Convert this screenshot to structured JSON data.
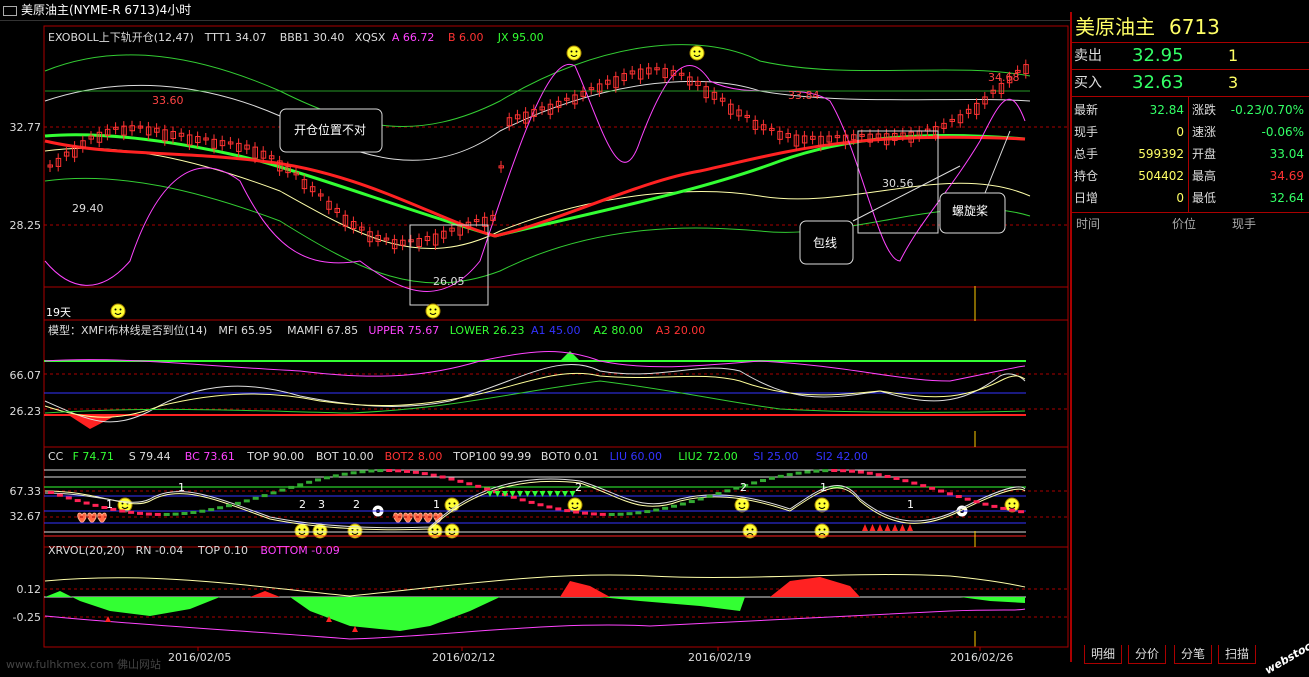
{
  "window": {
    "title": "美原油主(NYME-R 6713)4小时"
  },
  "main_panel": {
    "indicator_line": [
      {
        "text": "EXOBOLL上下轨开仓(12,47)",
        "color": "#dddddd"
      },
      {
        "text": "TTT1 34.07",
        "color": "#dddddd"
      },
      {
        "text": "BBB1 30.40",
        "color": "#dddddd"
      },
      {
        "text": "XQSX",
        "color": "#dddddd"
      },
      {
        "text": "A 66.72",
        "color": "#ff44ff"
      },
      {
        "text": "B 6.00",
        "color": "#ff3333"
      },
      {
        "text": "JX 95.00",
        "color": "#33ff33"
      }
    ],
    "y_ticks": [
      "32.77",
      "28.25"
    ],
    "price_labels": [
      "33.60",
      "29.40",
      "26.05",
      "33.84",
      "34.68",
      "30.56"
    ],
    "annotations": [
      "开仓位置不对",
      "包线",
      "螺旋桨"
    ],
    "days_label": "19天"
  },
  "mfi_panel": {
    "indicator_line": [
      {
        "text": "模型：XMFI布林线是否到位(14)",
        "color": "#dddddd"
      },
      {
        "text": "MFI 65.95",
        "color": "#dddddd"
      },
      {
        "text": "MAMFI 67.85",
        "color": "#dddddd"
      },
      {
        "text": "UPPER 75.67",
        "color": "#ff44ff"
      },
      {
        "text": "LOWER 26.23",
        "color": "#33ff33"
      },
      {
        "text": "A1 45.00",
        "color": "#3333ff"
      },
      {
        "text": "A2 80.00",
        "color": "#33ff33"
      },
      {
        "text": "A3 20.00",
        "color": "#ff3333"
      }
    ],
    "y_ticks": [
      "66.07",
      "26.23"
    ]
  },
  "cc_panel": {
    "indicator_line": [
      {
        "text": "CC",
        "color": "#dddddd"
      },
      {
        "text": "F 74.71",
        "color": "#33ff33"
      },
      {
        "text": "S 79.44",
        "color": "#dddddd"
      },
      {
        "text": "BC 73.61",
        "color": "#ff44ff"
      },
      {
        "text": "TOP 90.00",
        "color": "#dddddd"
      },
      {
        "text": "BOT 10.00",
        "color": "#dddddd"
      },
      {
        "text": "BOT2 8.00",
        "color": "#ff3333"
      },
      {
        "text": "TOP100 99.99",
        "color": "#dddddd"
      },
      {
        "text": "BOT0 0.01",
        "color": "#dddddd"
      },
      {
        "text": "LIU 60.00",
        "color": "#3333ff"
      },
      {
        "text": "LIU2 72.00",
        "color": "#33ff33"
      },
      {
        "text": "SI 25.00",
        "color": "#3333ff"
      },
      {
        "text": "SI2 42.00",
        "color": "#3333ff"
      }
    ],
    "y_ticks": [
      "67.33",
      "32.67"
    ],
    "markers": [
      "1",
      "1",
      "2",
      "3",
      "2",
      "1",
      "2",
      "2",
      "1",
      "1"
    ]
  },
  "xrvol_panel": {
    "indicator_line": [
      {
        "text": "XRVOL(20,20)",
        "color": "#dddddd"
      },
      {
        "text": "RN -0.04",
        "color": "#dddddd"
      },
      {
        "text": "TOP 0.10",
        "color": "#dddddd"
      },
      {
        "text": "BOTTOM -0.09",
        "color": "#ff44ff"
      }
    ],
    "y_ticks": [
      "0.12",
      "-0.25"
    ]
  },
  "x_axis": {
    "dates": [
      "2016/02/05",
      "2016/02/12",
      "2016/02/19",
      "2016/02/26"
    ]
  },
  "quote": {
    "symbol": "美原油主",
    "code": "6713",
    "sell": {
      "label": "卖出",
      "price": "32.95",
      "volume": "1"
    },
    "buy": {
      "label": "买入",
      "price": "32.63",
      "volume": "3"
    },
    "grid": [
      {
        "label": "最新",
        "value": "32.84",
        "color": "#33ff66"
      },
      {
        "label": "涨跌",
        "value": "-0.23/0.70%",
        "color": "#33ff66"
      },
      {
        "label": "现手",
        "value": "0",
        "color": "#ffff66"
      },
      {
        "label": "速涨",
        "value": "-0.06%",
        "color": "#33ff66"
      },
      {
        "label": "总手",
        "value": "599392",
        "color": "#ffff66"
      },
      {
        "label": "开盘",
        "value": "33.04",
        "color": "#33ff66"
      },
      {
        "label": "持仓",
        "value": "504402",
        "color": "#ffff66"
      },
      {
        "label": "最高",
        "value": "34.69",
        "color": "#ff3333"
      },
      {
        "label": "日增",
        "value": "0",
        "color": "#ffff66"
      },
      {
        "label": "最低",
        "value": "32.64",
        "color": "#33ff66"
      }
    ],
    "trades_headers": [
      "时间",
      "价位",
      "现手"
    ]
  },
  "tabs": [
    "明细",
    "分价",
    "分笔",
    "扫描"
  ],
  "footer": {
    "watermark": "www.fulhkmex.com 佛山网站",
    "logo": "webstock"
  }
}
